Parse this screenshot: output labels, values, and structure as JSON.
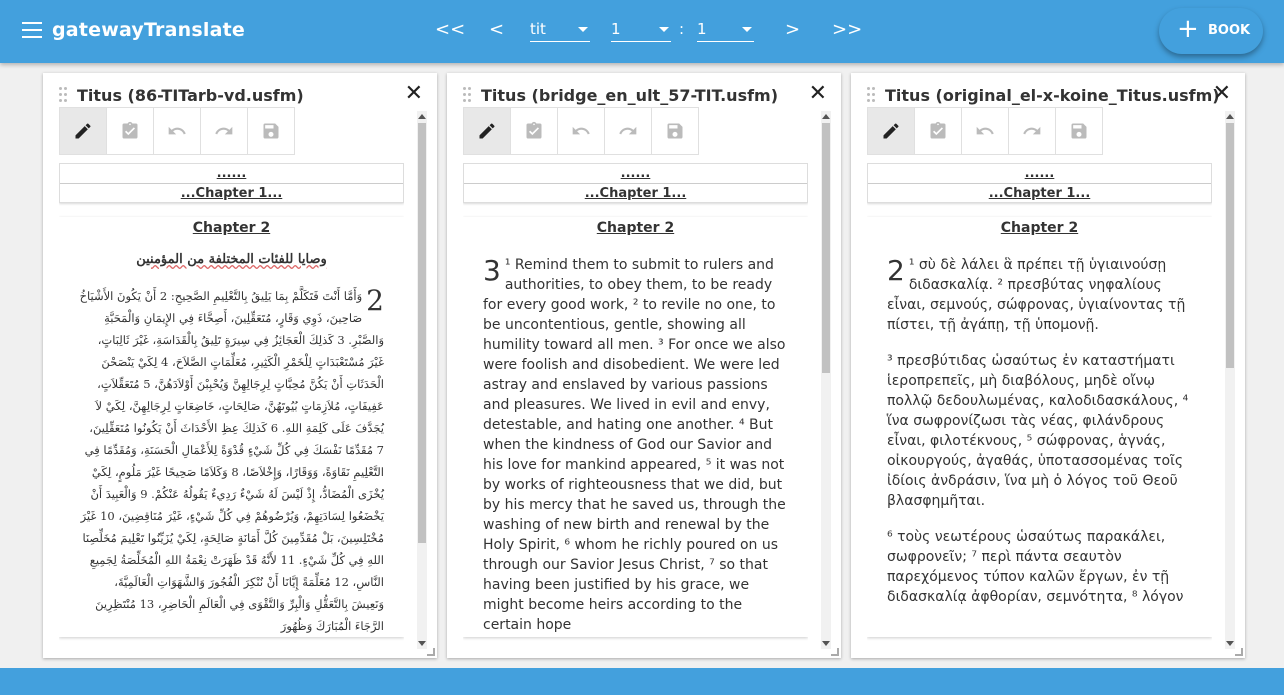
{
  "app": {
    "title": "gatewayTranslate"
  },
  "nav": {
    "first": "<<",
    "prev": "<",
    "next": ">",
    "last": ">>",
    "book_value": "tit",
    "chapter_value": "1",
    "separator": ":",
    "verse_value": "1",
    "add_book_label": "BOOK",
    "add_book_icon": "+"
  },
  "panes": [
    {
      "title": "Titus (86-TITarb-vd.usfm)",
      "prev_dots": "......",
      "prev_chapter": "...Chapter 1...",
      "chapter_heading": "Chapter 2",
      "section_heading": "وصايا للفئات المختلفة من المؤمنين",
      "chapter_number": "2",
      "text": "وَأَمَّا أَنْتَ فَتَكَلَّمْ بِمَا يَلِيقُ بِالتَّعْلِيمِ الصَّحِيحِ: 2 أَنْ يَكُونَ الأَشْيَاخُ صَاحِينَ، ذَوِي وَقَارٍ، مُتَعَقِّلِينَ، أَصِحَّاءَ فِي الإِيمَانِ وَالْمَحَبَّةِ وَالصَّبْرِ. 3 كَذلِكَ الْعَجَائِزُ فِي سِيرَةٍ تَلِيقُ بِالْقَدَاسَةِ، غَيْرَ ثَالِبَاتٍ، غَيْرَ مُسْتَعْبَدَاتٍ لِلْخَمْرِ الْكَثِيرِ، مُعَلِّمَاتٍ الصَّلاَحَ، 4 لِكَيْ يَنْصَحْنَ الْحَدَثَاتِ أَنْ يَكُنَّ مُحِبَّاتٍ لِرِجَالِهِنَّ وَيُحْبِبْنَ أَوْلاَدَهُنَّ، 5 مُتَعَقِّلاَتٍ، عَفِيفَاتٍ، مُلاَزِمَاتٍ بُيُوتَهُنَّ، صَالِحَاتٍ، خَاضِعَاتٍ لِرِجَالِهِنَّ، لِكَيْ لاَ يُجَدَّفَ عَلَى كَلِمَةِ اللهِ. 6 كَذلِكَ عِظِ الأَحْدَاثَ أَنْ يَكُونُوا مُتَعَقِّلِينَ، 7 مُقَدِّمًا نَفْسَكَ فِي كُلِّ شَيْءٍ قُدْوَةً لِلأَعْمَالِ الْحَسَنَةِ، وَمُقَدِّمًا فِي التَّعْلِيمِ نَقَاوَةً، وَوَقَارًا، وَإِخْلاَصًا، 8 وَكَلاَمًا صَحِيحًا غَيْرَ مَلُومٍ، لِكَيْ يُخْزَى الْمُضَادُّ، إِذْ لَيْسَ لَهُ شَيْءٌ رَدِيءٌ يَقُولُهُ عَنْكُمْ. 9 وَالْعَبِيدَ أَنْ يَخْضَعُوا لِسَادَتِهِمْ، وَيُرْضُوهُمْ فِي كُلِّ شَيْءٍ، غَيْرَ مُنَاقِضِينَ، 10 غَيْرَ مُخْتَلِسِينَ، بَلْ مُقَدِّمِينَ كُلَّ أَمَانَةٍ صَالِحَةٍ، لِكَيْ يُزَيِّنُوا تَعْلِيمَ مُخَلِّصِنَا اللهِ فِي كُلِّ شَيْءٍ. 11 لأَنَّهُ قَدْ ظَهَرَتْ نِعْمَةُ اللهِ الْمُخَلِّصَةُ لِجَمِيعِ النَّاسِ، 12 مُعَلِّمَةً إِيَّانَا أَنْ نُنْكِرَ الْفُجُورَ وَالشَّهَوَاتِ الْعَالَمِيَّةَ، وَنَعِيشَ بِالتَّعَقُّلِ وَالْبِرِّ وَالتَّقْوَى فِي الْعَالَمِ الْحَاضِرِ، 13 مُنْتَظِرِينَ الرَّجَاءَ الْمُبَارَكَ وَظُهُورَ"
    },
    {
      "title": "Titus (bridge_en_ult_57-TIT.usfm)",
      "prev_dots": "......",
      "prev_chapter": "...Chapter 1...",
      "chapter_heading": "Chapter 2",
      "chapter_number": "3",
      "text": "¹ Remind them to submit to rulers and authorities, to obey them, to be ready for every good work, ² to revile no one, to be uncontentious, gentle, showing all humility toward all men. ³ For once we also were foolish and disobedient. We were led astray and enslaved by various passions and pleasures. We lived in evil and envy, detestable, and hating one another. ⁴ But when the kindness of God our Savior and his love for mankind appeared, ⁵ it was not by works of righteousness that we did, but by his mercy that he saved us, through the washing of new birth and renewal by the Holy Spirit, ⁶ whom he richly poured on us through our Savior Jesus Christ, ⁷ so that having been justified by his grace, we might become heirs according to the certain hope"
    },
    {
      "title": "Titus (original_el-x-koine_Titus.usfm)",
      "prev_dots": "......",
      "prev_chapter": "...Chapter 1...",
      "chapter_heading": "Chapter 2",
      "chapter_number": "2",
      "paragraphs": [
        "¹ σὺ δὲ λάλει ἃ πρέπει τῇ ὑγιαινούσῃ διδασκαλίᾳ. ² πρεσβύτας νηφαλίους εἶναι, σεμνούς, σώφρονας, ὑγιαίνοντας τῇ πίστει, τῇ ἀγάπῃ, τῇ ὑπομονῇ.",
        "³ πρεσβύτιδας ὡσαύτως ἐν καταστήματι ἱεροπρεπεῖς, μὴ διαβόλους, μηδὲ οἴνῳ πολλῷ δεδουλωμένας, καλοδιδασκάλους, ⁴ ἵνα σωφρονίζωσι τὰς νέας, φιλάνδρους εἶναι, φιλοτέκνους, ⁵ σώφρονας, ἁγνάς, οἰκουργούς, ἀγαθάς, ὑποτασσομένας τοῖς ἰδίοις ἀνδράσιν, ἵνα μὴ ὁ λόγος τοῦ Θεοῦ βλασφημῆται.",
        "⁶ τοὺς νεωτέρους ὡσαύτως παρακάλει, σωφρονεῖν; ⁷ περὶ πάντα σεαυτὸν παρεχόμενος τύπον καλῶν ἔργων, ἐν τῇ διδασκαλίᾳ ἀφθορίαν, σεμνότητα, ⁸ λόγον"
      ]
    }
  ]
}
